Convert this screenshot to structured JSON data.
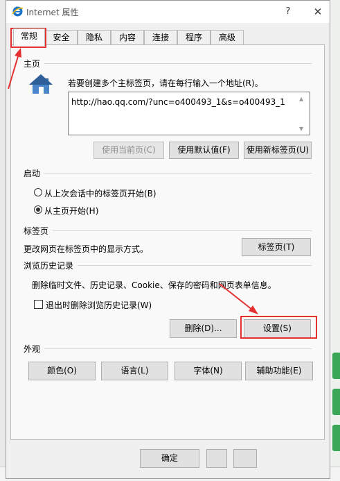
{
  "window": {
    "title": "Internet 属性",
    "help_label": "?",
    "close_label": "✕"
  },
  "tabs": [
    {
      "label": "常规",
      "active": true
    },
    {
      "label": "安全",
      "active": false
    },
    {
      "label": "隐私",
      "active": false
    },
    {
      "label": "内容",
      "active": false
    },
    {
      "label": "连接",
      "active": false
    },
    {
      "label": "程序",
      "active": false
    },
    {
      "label": "高级",
      "active": false
    }
  ],
  "homepage": {
    "section_label": "主页",
    "instruction": "若要创建多个主标签页，请在每行输入一个地址(R)。",
    "url_value": "http://hao.qq.com/?unc=o400493_1&s=o400493_1",
    "use_current_label": "使用当前页(C)",
    "use_default_label": "使用默认值(F)",
    "use_new_tab_label": "使用新标签页(U)"
  },
  "startup": {
    "section_label": "启动",
    "option_last_session": "从上次会话中的标签页开始(B)",
    "option_homepage": "从主页开始(H)",
    "selected": "homepage"
  },
  "tabs_section": {
    "section_label": "标签页",
    "description": "更改网页在标签页中的显示方式。",
    "button_label": "标签页(T)"
  },
  "history": {
    "section_label": "浏览历史记录",
    "description": "删除临时文件、历史记录、Cookie、保存的密码和网页表单信息。",
    "delete_on_exit_label": "退出时删除浏览历史记录(W)",
    "delete_on_exit_checked": false,
    "delete_button_label": "删除(D)...",
    "settings_button_label": "设置(S)"
  },
  "appearance": {
    "section_label": "外观",
    "colors_label": "颜色(O)",
    "languages_label": "语言(L)",
    "fonts_label": "字体(N)",
    "accessibility_label": "辅助功能(E)"
  },
  "footer": {
    "ok_label": "确定",
    "cancel_label": "",
    "apply_label": ""
  },
  "colors": {
    "annotation_red": "#e53030",
    "ie_blue": "#1a73c8"
  }
}
